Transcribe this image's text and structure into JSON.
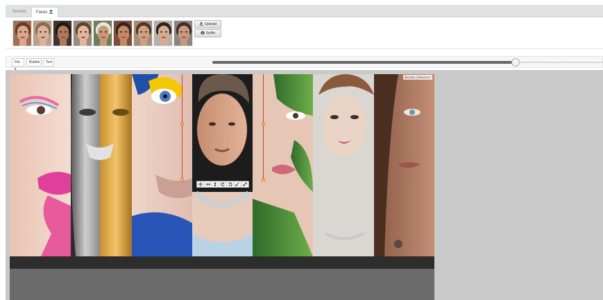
{
  "tabs": [
    {
      "label": "Scenes"
    },
    {
      "label": "Faces",
      "icon": "upload-icon"
    }
  ],
  "faces": {
    "thumbnails": [
      {
        "hair": "#6a3b22",
        "skin": "#d9a88a",
        "bg": "#a07055"
      },
      {
        "hair": "#8a6a52",
        "skin": "#dbb39c",
        "bg": "#b9a08d"
      },
      {
        "hair": "#1e1612",
        "skin": "#b07858",
        "bg": "#3d3630"
      },
      {
        "hair": "#5c4430",
        "skin": "#e0b69e",
        "bg": "#9a8b7c"
      },
      {
        "hair": "#e6e6e2",
        "skin": "#c79978",
        "bg": "#6d7f58"
      },
      {
        "hair": "#3a241a",
        "skin": "#c48866",
        "bg": "#7a4e3a"
      },
      {
        "hair": "#4a3626",
        "skin": "#cf9f82",
        "bg": "#a48c78"
      },
      {
        "hair": "#2a2220",
        "skin": "#d6aa8e",
        "bg": "#b3b0ac"
      },
      {
        "hair": "#3c2e26",
        "skin": "#c9987b",
        "bg": "#8a8684"
      }
    ],
    "upload_label": "Upload",
    "selfie_label": "Selfie"
  },
  "toolbar": {
    "file_label": "File ▾",
    "bubble_label": "Bubble",
    "text_label": "Text",
    "zoom_level": 0.777
  },
  "stage": {
    "coordinates": "605,182 | 315x410 0°"
  },
  "face_tools": [
    "move-icon",
    "flip-horizontal-icon",
    "flip-vertical-icon",
    "rotate-left-icon",
    "rotate-right-icon",
    "shrink-icon",
    "expand-icon"
  ],
  "colors": {
    "panel_bg": "#dfe1e3",
    "stage_bg": "#c9c9c9",
    "selection_line": "#d23a3a",
    "handle": "#e28a2a"
  }
}
